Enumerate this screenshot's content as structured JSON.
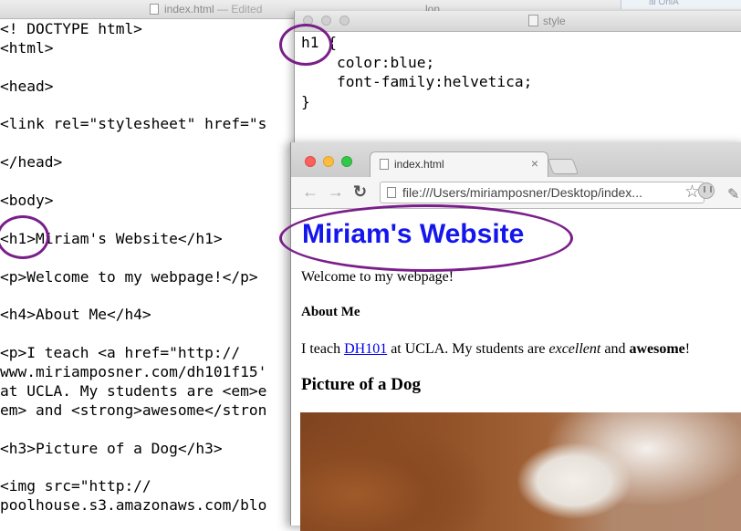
{
  "editor": {
    "title": "index.html",
    "edited": "— Edited",
    "behind_title": "lon",
    "behind_right": "al OnlA",
    "code_lines": [
      "<! DOCTYPE html>",
      "<html>",
      "",
      "<head>",
      "",
      "<link rel=\"stylesheet\" href=\"s",
      "",
      "</head>",
      "",
      "<body>",
      "",
      "<h1>Miriam's Website</h1>",
      "",
      "<p>Welcome to my webpage!</p>",
      "",
      "<h4>About Me</h4>",
      "",
      "<p>I teach <a href=\"http://",
      "www.miriamposner.com/dh101f15'",
      "at UCLA. My students are <em>e",
      "em> and <strong>awesome</stron",
      "",
      "<h3>Picture of a Dog</h3>",
      "",
      "<img src=\"http://",
      "poolhouse.s3.amazonaws.com/blo"
    ]
  },
  "style_window": {
    "title": "style",
    "code_lines": [
      "h1 {",
      "    color:blue;",
      "    font-family:helvetica;",
      "}"
    ]
  },
  "browser": {
    "tab_title": "index.html",
    "tab_close": "×",
    "url": "file:///Users/miriamposner/Desktop/index...",
    "back": "←",
    "forward": "→",
    "reload": "↻",
    "star": "☆",
    "page": {
      "h1": "Miriam's Website",
      "welcome": "Welcome to my webpage!",
      "about": "About Me",
      "teach_prefix": "I teach ",
      "link_text": "DH101",
      "teach_mid": " at UCLA. My students are ",
      "em_text": "excellent",
      "and_text": " and ",
      "strong_text": "awesome",
      "end_text": "!",
      "h3": "Picture of a Dog"
    }
  },
  "annotation_color": "#7a1e8a"
}
